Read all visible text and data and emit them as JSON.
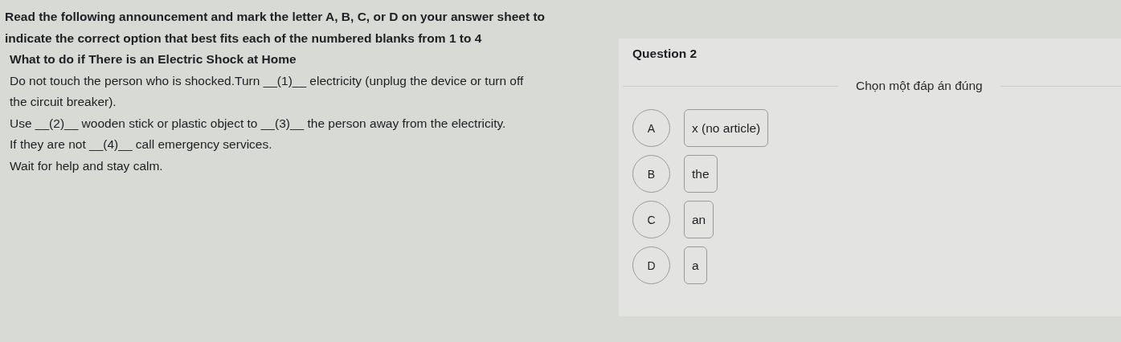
{
  "instructions": {
    "lines": [
      "Read the following announcement and mark the letter A, B, C, or D on your answer sheet to",
      "indicate the correct option that best fits each of the numbered blanks from 1 to 4"
    ]
  },
  "passage": {
    "title": "What to do if There is an Electric Shock at Home",
    "lines": [
      "Do not touch the person who is shocked.Turn __(1)__ electricity (unplug the device or turn off",
      "the circuit breaker).",
      "Use __(2)__ wooden stick or plastic object to __(3)__ the person away from the electricity.",
      "If they are not __(4)__ call emergency services.",
      "Wait for help and stay calm."
    ]
  },
  "question": {
    "title": "Question 2",
    "prompt": "Chọn một đáp án đúng",
    "options": [
      {
        "letter": "A",
        "text": "x (no article)",
        "selected": false
      },
      {
        "letter": "B",
        "text": "the",
        "selected": false
      },
      {
        "letter": "C",
        "text": "an",
        "selected": false
      },
      {
        "letter": "D",
        "text": "a",
        "selected": false
      }
    ]
  }
}
